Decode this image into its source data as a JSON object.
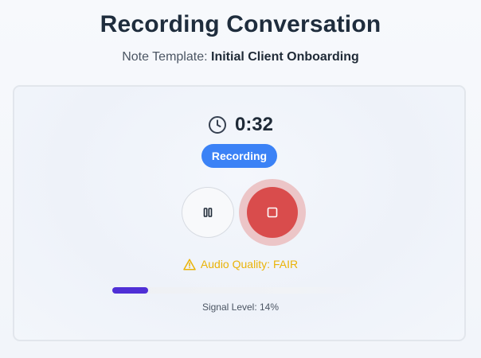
{
  "header": {
    "title": "Recording Conversation",
    "template_label": "Note Template:",
    "template_name": "Initial Client Onboarding"
  },
  "recorder": {
    "timer_icon": "clock-icon",
    "elapsed": "0:32",
    "status": "Recording",
    "status_color": "#3b82f6",
    "pause_icon": "pause-icon",
    "stop_icon": "stop-icon",
    "stop_color": "#d94c4c"
  },
  "quality": {
    "icon": "warning-icon",
    "text": "Audio Quality: FAIR",
    "color": "#eab308"
  },
  "signal": {
    "level_percent": 14,
    "text": "Signal Level: 14%",
    "bar_color": "#4f2fd6"
  }
}
